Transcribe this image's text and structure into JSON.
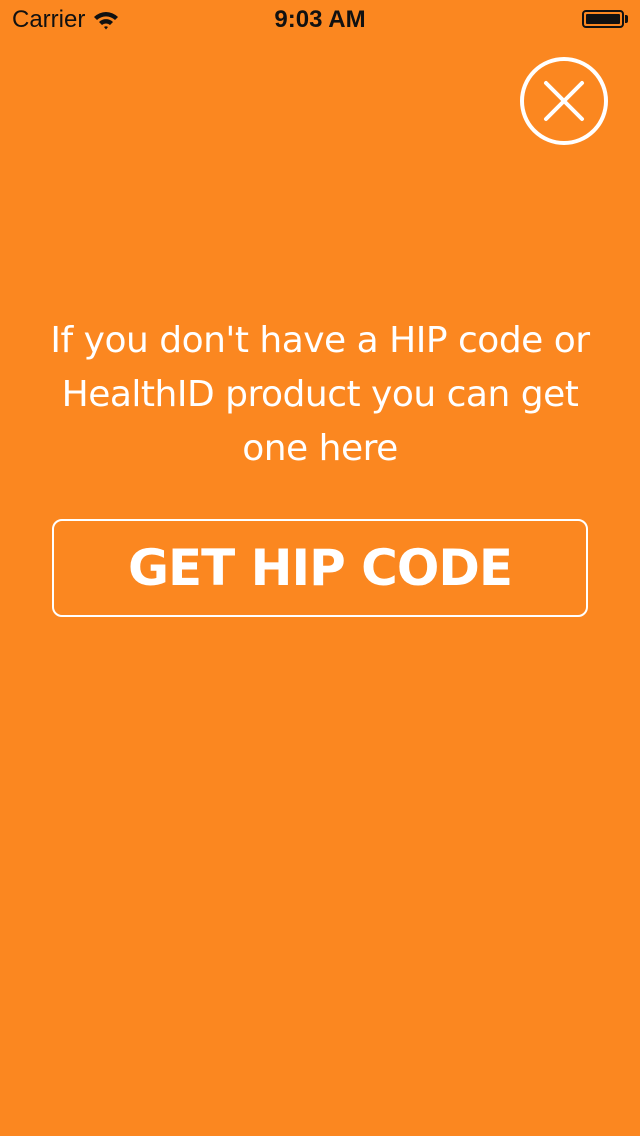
{
  "status_bar": {
    "carrier": "Carrier",
    "time": "9:03 AM"
  },
  "close": {
    "icon": "close-icon"
  },
  "message": {
    "text": "If you don't have a HIP code or HealthID product you can get one here"
  },
  "hip_button": {
    "label": "GET HIP CODE"
  },
  "colors": {
    "background": "#FB8720",
    "foreground": "#FFFFFF",
    "status_text": "#111111"
  }
}
